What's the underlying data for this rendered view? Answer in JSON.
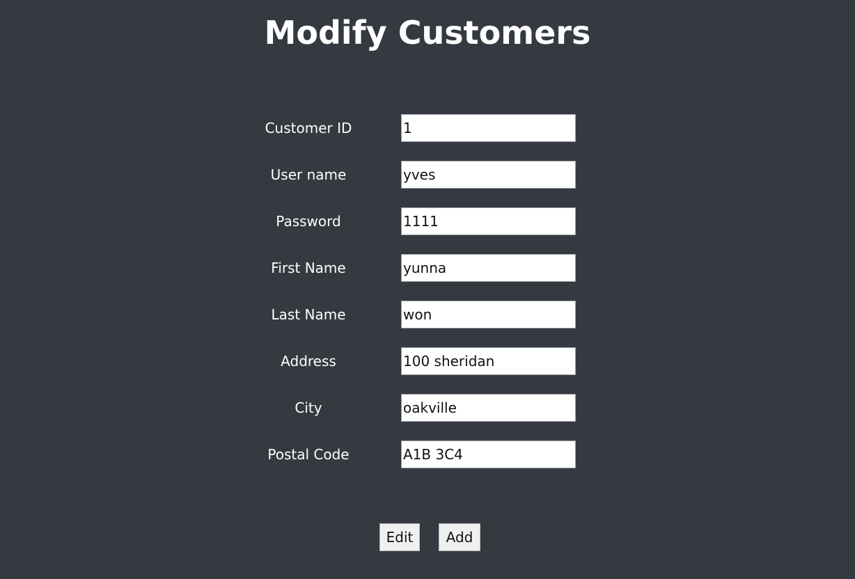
{
  "page": {
    "title": "Modify Customers"
  },
  "form": {
    "fields": [
      {
        "label": "Customer ID",
        "value": "1"
      },
      {
        "label": "User name",
        "value": "yves"
      },
      {
        "label": "Password",
        "value": "1111"
      },
      {
        "label": "First Name",
        "value": "yunna"
      },
      {
        "label": "Last Name",
        "value": "won"
      },
      {
        "label": "Address",
        "value": "100 sheridan"
      },
      {
        "label": "City",
        "value": "oakville"
      },
      {
        "label": "Postal Code",
        "value": "A1B 3C4"
      }
    ]
  },
  "actions": {
    "edit_label": "Edit",
    "add_label": "Add"
  },
  "colors": {
    "background": "#353940",
    "text": "#ffffff",
    "input_background": "#ffffff",
    "button_background": "#f0f0f0"
  }
}
